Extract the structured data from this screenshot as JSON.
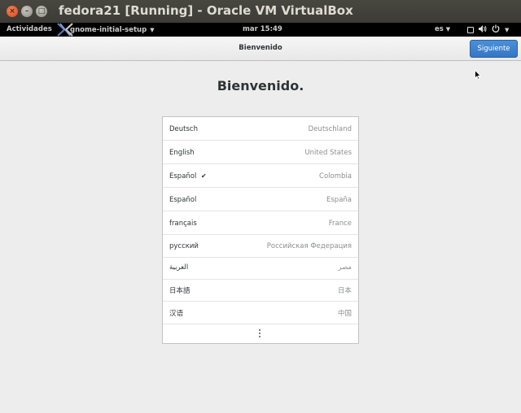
{
  "window": {
    "title": "fedora21 [Running] - Oracle VM VirtualBox"
  },
  "topbar": {
    "activities": "Actividades",
    "app_name": "gnome-initial-setup",
    "clock": "mar 15:49",
    "keyboard_layout": "es"
  },
  "header": {
    "title": "Bienvenido",
    "next_label": "Siguiente"
  },
  "main": {
    "heading": "Bienvenido."
  },
  "languages": [
    {
      "name": "Deutsch",
      "region": "Deutschland",
      "selected": false
    },
    {
      "name": "English",
      "region": "United States",
      "selected": false
    },
    {
      "name": "Español",
      "region": "Colombia",
      "selected": true
    },
    {
      "name": "Español",
      "region": "España",
      "selected": false
    },
    {
      "name": "français",
      "region": "France",
      "selected": false
    },
    {
      "name": "русский",
      "region": "Российская Федерация",
      "selected": false
    },
    {
      "name": "العربية",
      "region": "مصر",
      "selected": false
    },
    {
      "name": "日本語",
      "region": "日本",
      "selected": false
    },
    {
      "name": "汉语",
      "region": "中国",
      "selected": false
    }
  ],
  "icons": {
    "selected_check": "✔",
    "more": "vertical-ellipsis-icon"
  },
  "colors": {
    "accent": "#3d80cc",
    "topbar": "#000000",
    "background": "#ededed"
  }
}
